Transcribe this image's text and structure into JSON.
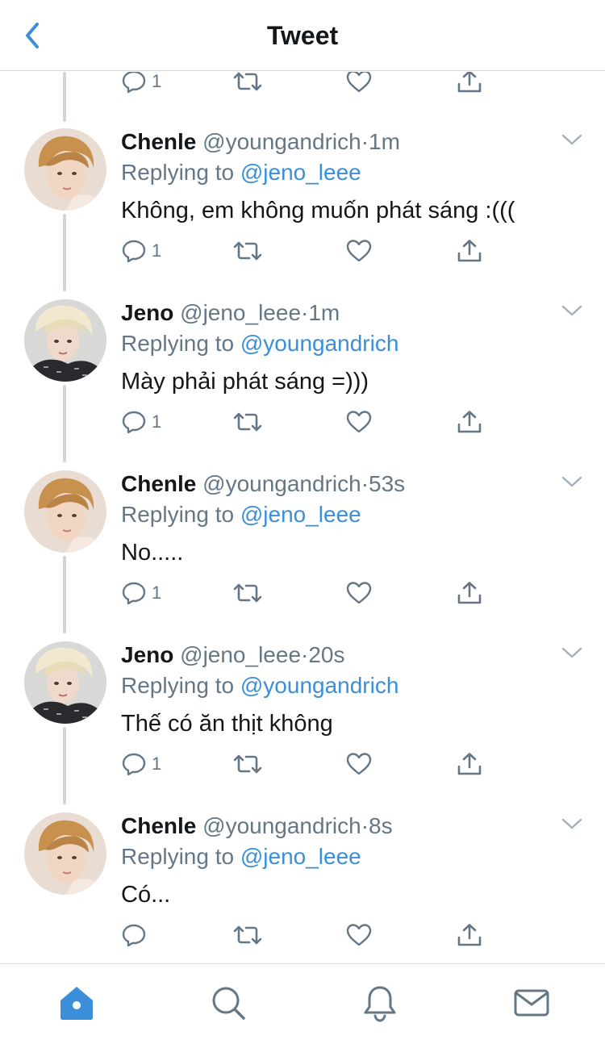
{
  "header": {
    "title": "Tweet",
    "back_icon": "chevron-left-icon"
  },
  "colors": {
    "accent": "#3b8fd8",
    "muted": "#657786",
    "text": "#14171a",
    "divider": "#d9dde1",
    "rail": "#ccd6dd"
  },
  "top_actions": {
    "reply_count": "1"
  },
  "tweets": [
    {
      "name": "Chenle",
      "handle": "@youngandrich",
      "sep": "·",
      "time": "1m",
      "replying_prefix": "Replying to",
      "replying_to": "@jeno_leee",
      "text": "Không, em không muốn phát sáng :(((",
      "reply_count": "1"
    },
    {
      "name": "Jeno",
      "handle": "@jeno_leee",
      "sep": "·",
      "time": "1m",
      "replying_prefix": "Replying to",
      "replying_to": "@youngandrich",
      "text": "Mày phải phát sáng =)))",
      "reply_count": "1"
    },
    {
      "name": "Chenle",
      "handle": "@youngandrich",
      "sep": "·",
      "time": "53s",
      "replying_prefix": "Replying to",
      "replying_to": "@jeno_leee",
      "text": "No.....",
      "reply_count": "1"
    },
    {
      "name": "Jeno",
      "handle": "@jeno_leee",
      "sep": "·",
      "time": "20s",
      "replying_prefix": "Replying to",
      "replying_to": "@youngandrich",
      "text": "Thế có ăn thịt không",
      "reply_count": "1"
    },
    {
      "name": "Chenle",
      "handle": "@youngandrich",
      "sep": "·",
      "time": "8s",
      "replying_prefix": "Replying to",
      "replying_to": "@jeno_leee",
      "text": "Có...",
      "reply_count": ""
    }
  ],
  "tabbar": [
    "home-icon",
    "search-icon",
    "bell-icon",
    "mail-icon"
  ]
}
